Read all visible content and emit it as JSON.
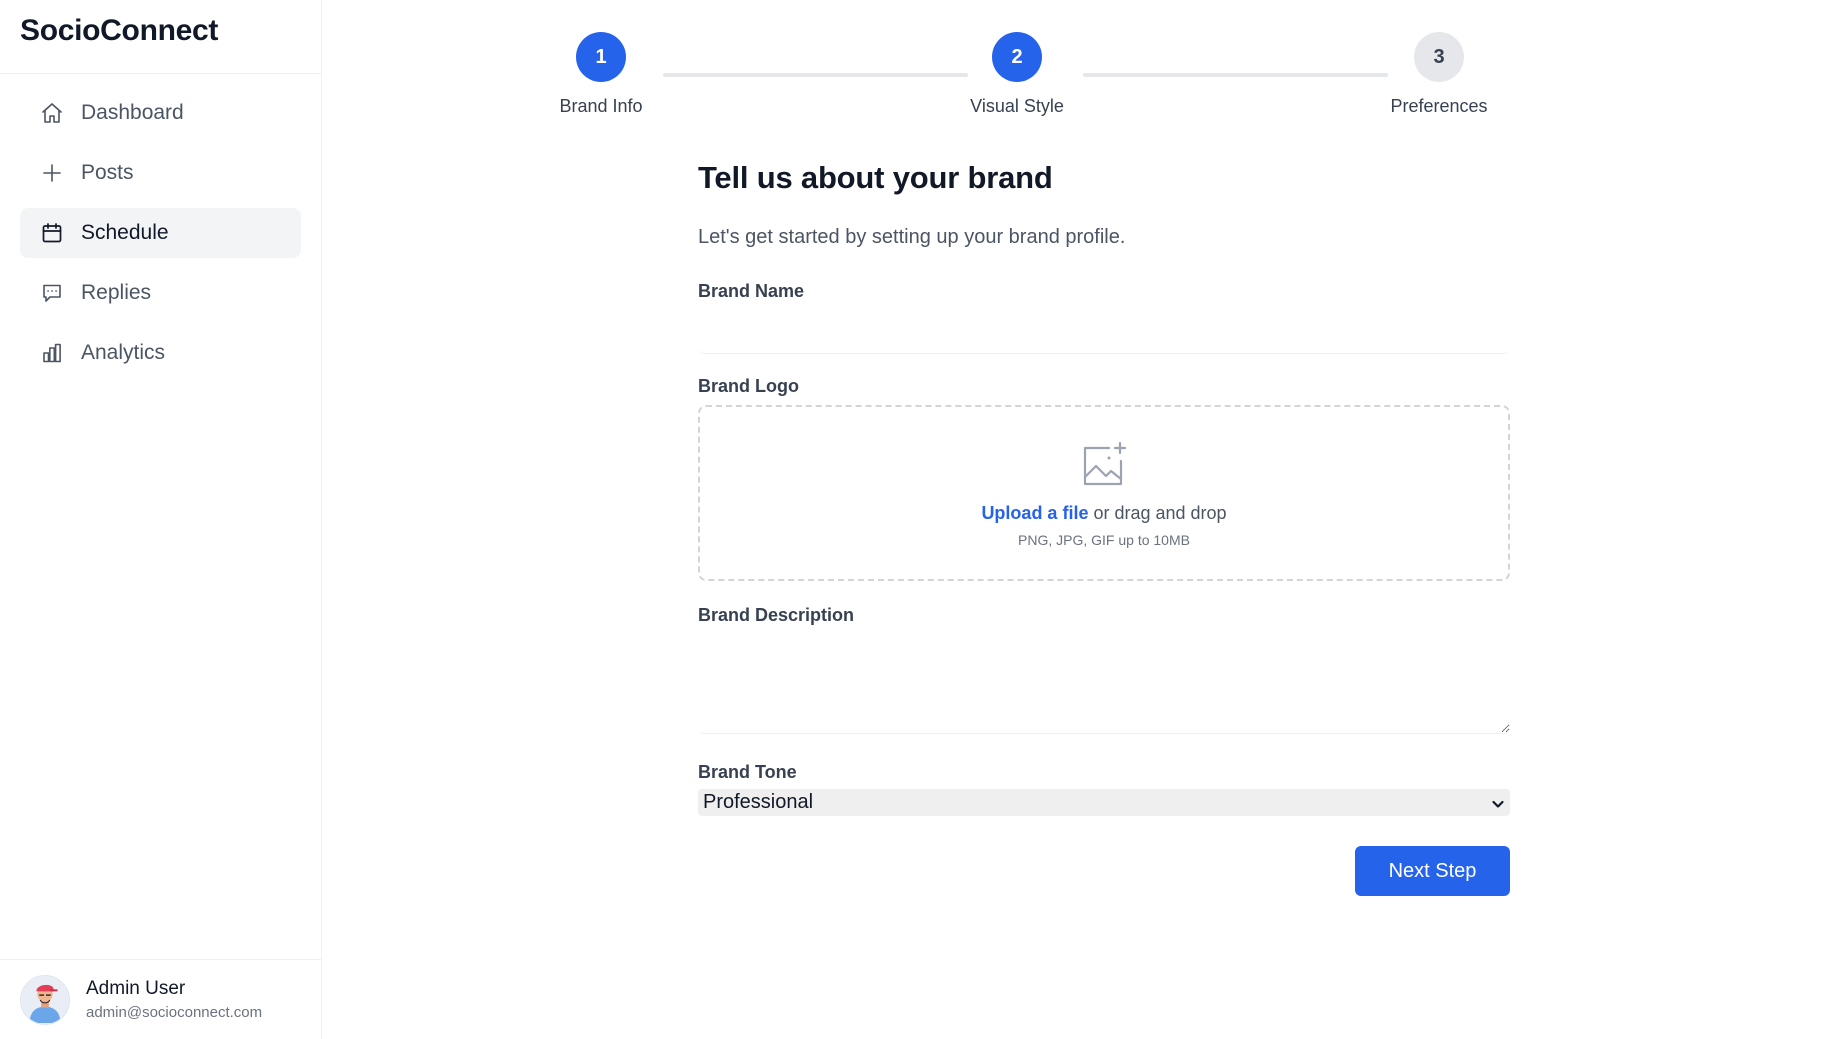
{
  "app": {
    "title": "SocioConnect"
  },
  "sidebar": {
    "items": [
      {
        "label": "Dashboard",
        "icon": "home-icon",
        "active": false
      },
      {
        "label": "Posts",
        "icon": "plus-icon",
        "active": false
      },
      {
        "label": "Schedule",
        "icon": "calendar-icon",
        "active": true
      },
      {
        "label": "Replies",
        "icon": "chat-bubble-icon",
        "active": false
      },
      {
        "label": "Analytics",
        "icon": "bar-chart-icon",
        "active": false
      }
    ]
  },
  "user": {
    "name": "Admin User",
    "email": "admin@socioconnect.com",
    "avatar_icon": "avatar-icon"
  },
  "stepper": {
    "steps": [
      {
        "number": "1",
        "label": "Brand Info",
        "state": "complete"
      },
      {
        "number": "2",
        "label": "Visual Style",
        "state": "complete"
      },
      {
        "number": "3",
        "label": "Preferences",
        "state": "pending"
      }
    ]
  },
  "form": {
    "title": "Tell us about your brand",
    "subtitle": "Let's get started by setting up your brand profile.",
    "brand_name": {
      "label": "Brand Name",
      "value": "",
      "placeholder": ""
    },
    "brand_logo": {
      "label": "Brand Logo",
      "upload_link": "Upload a file",
      "upload_text": " or drag and drop",
      "hint": "PNG, JPG, GIF up to 10MB",
      "icon": "image-add-icon"
    },
    "brand_description": {
      "label": "Brand Description",
      "value": "",
      "placeholder": ""
    },
    "brand_tone": {
      "label": "Brand Tone",
      "selected": "Professional"
    },
    "next_button": "Next Step"
  },
  "colors": {
    "accent": "#2563eb",
    "active_nav_bg": "#f3f4f6",
    "pending_step_bg": "#e5e7eb"
  }
}
